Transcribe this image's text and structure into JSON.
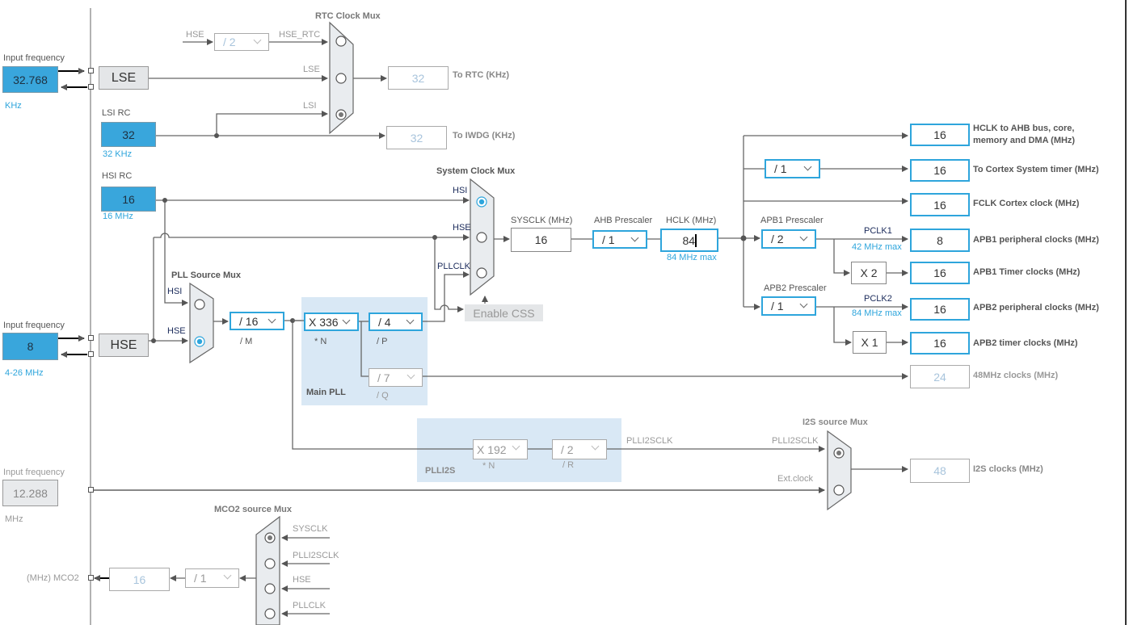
{
  "colors": {
    "selected_border": "#2ea5dc",
    "input_fill": "#39a6dc",
    "pll_panel": "#d9e8f5",
    "wire": "#555555"
  },
  "inputs": {
    "lse": {
      "label": "Input frequency",
      "value": "32.768",
      "unit": "KHz",
      "source": "LSE"
    },
    "lsi": {
      "label": "LSI RC",
      "value": "32",
      "unit": "32 KHz"
    },
    "hsi": {
      "label": "HSI RC",
      "value": "16",
      "unit": "16 MHz"
    },
    "hse": {
      "label": "Input frequency",
      "value": "8",
      "unit": "4-26 MHz",
      "source": "HSE"
    },
    "ext": {
      "label": "Input frequency",
      "value": "12.288",
      "unit": "MHz"
    }
  },
  "rtc": {
    "mux_title": "RTC Clock Mux",
    "hse_label": "HSE",
    "hse_div": "/ 2",
    "hse_rtc_label": "HSE_RTC",
    "lse_label": "LSE",
    "lsi_label": "LSI",
    "selected": "LSI",
    "rtc_value": "32",
    "rtc_label": "To RTC (KHz)",
    "iwdg_value": "32",
    "iwdg_label": "To IWDG (KHz)"
  },
  "sysclk_mux": {
    "title": "System Clock Mux",
    "hsi": "HSI",
    "hse": "HSE",
    "pllclk": "PLLCLK",
    "selected": "HSI",
    "enable_css": "Enable CSS"
  },
  "pll_src_mux": {
    "title": "PLL Source Mux",
    "hsi": "HSI",
    "hse": "HSE",
    "selected": "HSE"
  },
  "main_pll": {
    "title": "Main PLL",
    "m": "/ 16",
    "m_label": "/ M",
    "n": "X 336",
    "n_label": "* N",
    "p": "/ 4",
    "p_label": "/ P",
    "q": "/ 7",
    "q_label": "/ Q"
  },
  "plli2s": {
    "title": "PLLI2S",
    "n": "X 192",
    "n_label": "* N",
    "r": "/ 2",
    "r_label": "/ R",
    "out_label": "PLLI2SCLK"
  },
  "sys": {
    "sysclk_label": "SYSCLK (MHz)",
    "sysclk": "16",
    "ahb_label": "AHB Prescaler",
    "ahb": "/ 1",
    "hclk_label": "HCLK (MHz)",
    "hclk": "84",
    "hclk_max": "84 MHz max",
    "apb1_label": "APB1 Prescaler",
    "apb1": "/ 2",
    "apb2_label": "APB2 Prescaler",
    "apb2": "/ 1",
    "cortex_div": "/ 1",
    "pclk1": "PCLK1",
    "pclk1_max": "42 MHz max",
    "pclk2": "PCLK2",
    "pclk2_max": "84 MHz max",
    "x2": "X 2",
    "x1": "X 1"
  },
  "outputs": [
    {
      "value": "16",
      "label1": "HCLK to AHB bus, core,",
      "label2": "memory and DMA (MHz)"
    },
    {
      "value": "16",
      "label1": "To Cortex System timer (MHz)"
    },
    {
      "value": "16",
      "label1": "FCLK Cortex clock (MHz)"
    },
    {
      "value": "8",
      "label1": "APB1 peripheral clocks (MHz)"
    },
    {
      "value": "16",
      "label1": "APB1 Timer clocks (MHz)"
    },
    {
      "value": "16",
      "label1": "APB2 peripheral clocks (MHz)"
    },
    {
      "value": "16",
      "label1": "APB2 timer clocks (MHz)"
    },
    {
      "value": "24",
      "label1": "48MHz clocks (MHz)"
    },
    {
      "value": "48",
      "label1": "I2S clocks (MHz)"
    }
  ],
  "i2s_mux": {
    "title": "I2S source Mux",
    "plli2sclk": "PLLI2SCLK",
    "ext": "Ext.clock",
    "selected": "PLLI2SCLK"
  },
  "mco2": {
    "title": "MCO2 source Mux",
    "sysclk": "SYSCLK",
    "plli2sclk": "PLLI2SCLK",
    "hse": "HSE",
    "pllclk": "PLLCLK",
    "selected": "SYSCLK",
    "div": "/ 1",
    "value": "16",
    "label": "(MHz) MCO2"
  }
}
